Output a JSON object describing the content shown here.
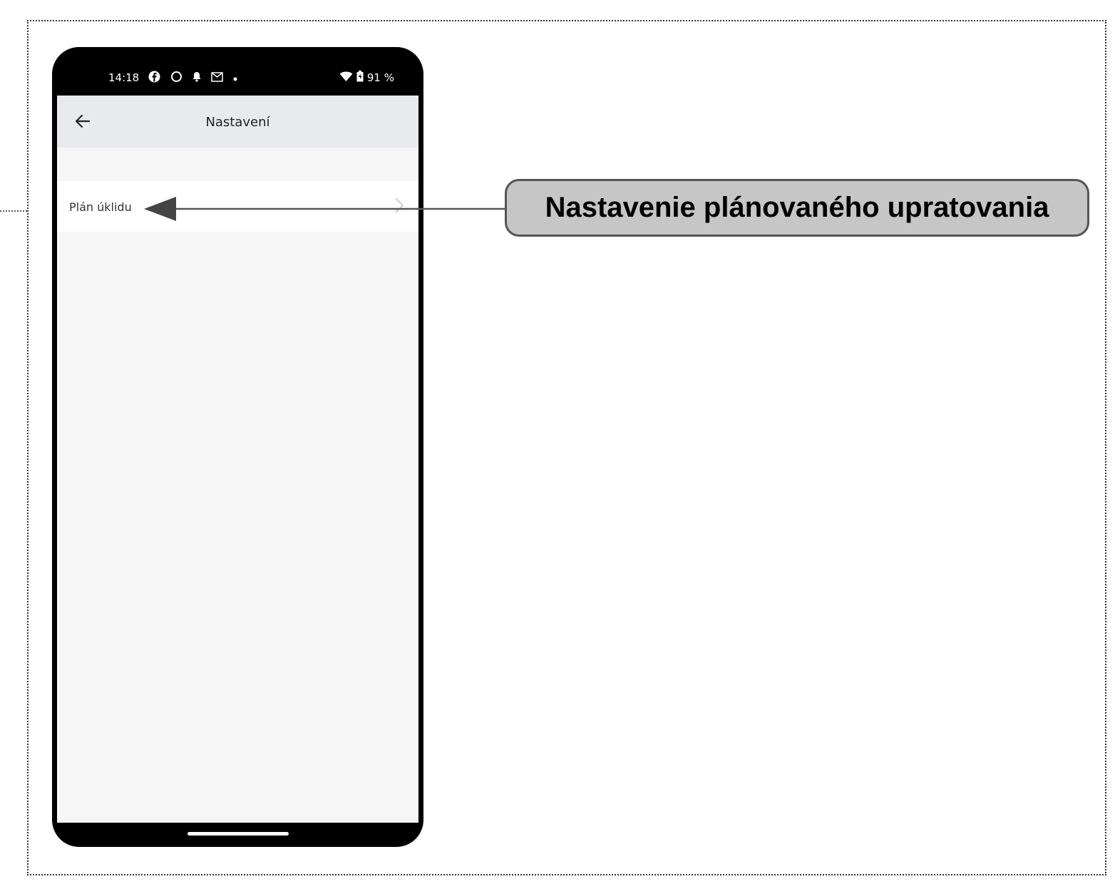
{
  "statusbar": {
    "time": "14:18",
    "battery_text": "91 %",
    "icons_left": [
      "facebook-icon",
      "circle-app-icon",
      "notification-bell-icon",
      "gmail-icon",
      "dot-icon"
    ],
    "icons_right": [
      "wifi-icon",
      "battery-icon"
    ]
  },
  "appbar": {
    "title": "Nastavení",
    "back_icon": "arrow-left-icon"
  },
  "settings_list": [
    {
      "label": "Plán úklidu",
      "trailing_icon": "chevron-right-icon"
    }
  ],
  "annotation": {
    "text": "Nastavenie plánovaného upratovania"
  },
  "colors": {
    "appbar_bg": "#e9eaed",
    "screen_bg": "#f6f6f6",
    "callout_bg": "#c6c6c6",
    "callout_border": "#555555"
  }
}
